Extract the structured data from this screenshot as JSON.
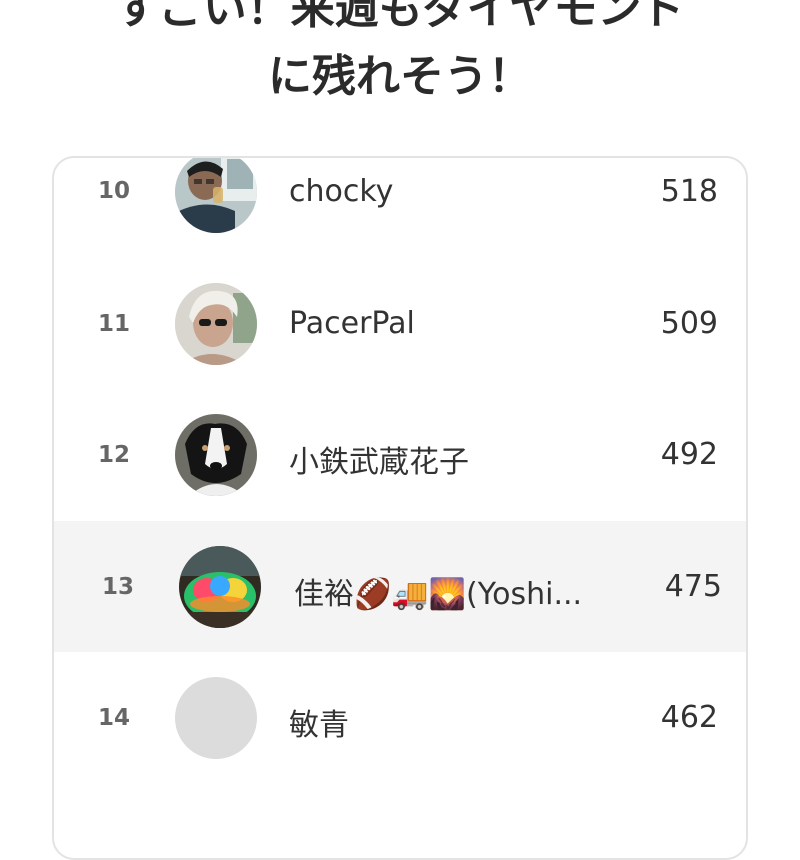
{
  "header": {
    "line1": "すごい！来週もダイヤモンド",
    "line2": "に残れそう！"
  },
  "leaderboard": {
    "rows": [
      {
        "rank": "10",
        "name": "chocky",
        "score": "518",
        "avatar": "person-drinking-photo"
      },
      {
        "rank": "11",
        "name": "PacerPal",
        "score": "509",
        "avatar": "person-sunglasses-photo"
      },
      {
        "rank": "12",
        "name": "小鉄武蔵花子",
        "score": "492",
        "avatar": "dog-photo"
      },
      {
        "rank": "13",
        "name": "佳裕🏈🚚🌄(Yoshi...",
        "score": "475",
        "avatar": "illuminated-dome-photo",
        "highlighted": true
      },
      {
        "rank": "14",
        "name": "敏青",
        "score": "462",
        "avatar": "default-avatar"
      }
    ]
  },
  "colors": {
    "highlight_row": "#f4f4f4",
    "card_border": "#e3e3e3",
    "text": "#2b2b2b",
    "rank_text": "#666666"
  }
}
